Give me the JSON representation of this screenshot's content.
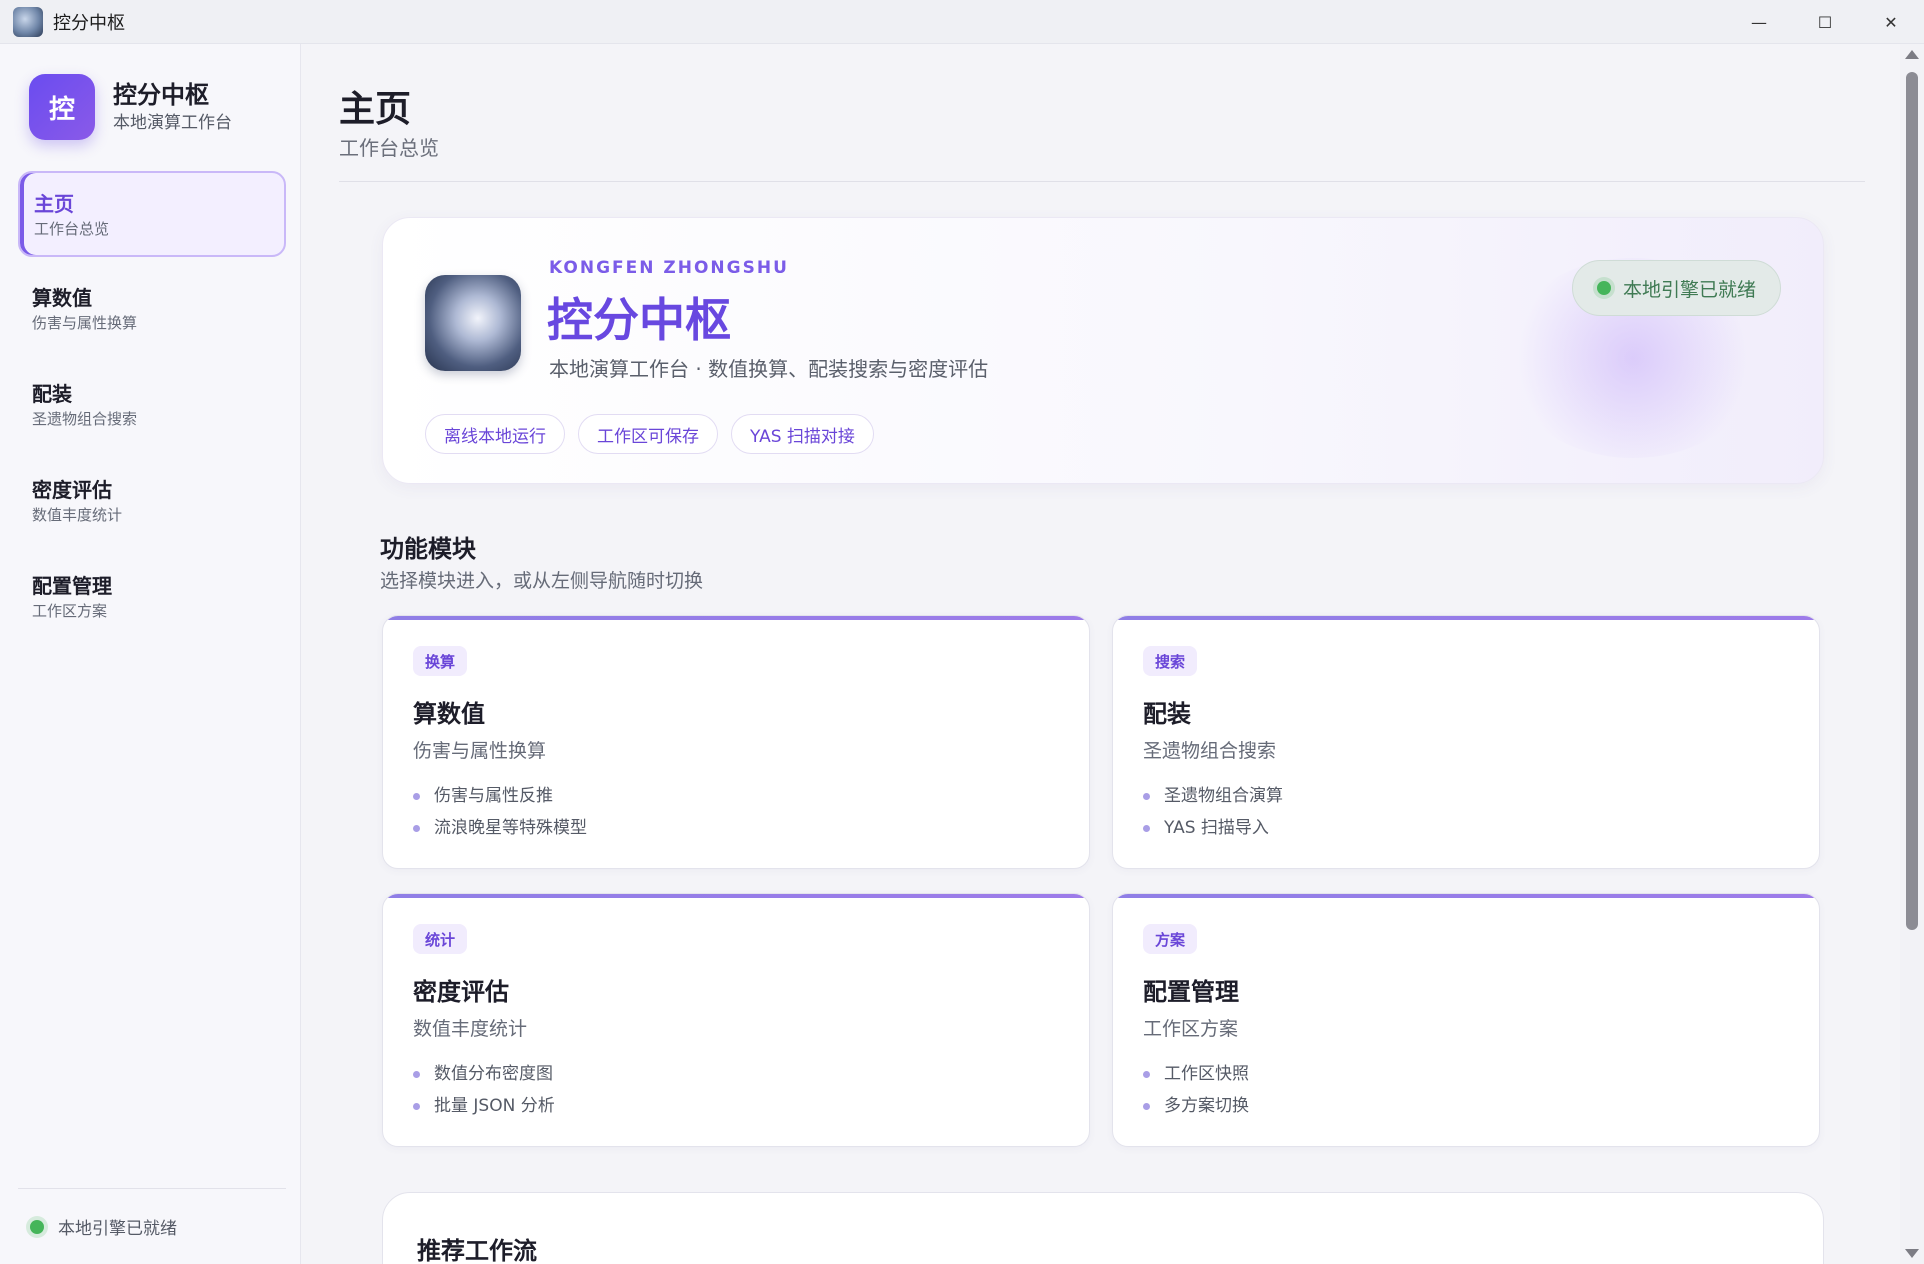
{
  "window": {
    "title": "控分中枢",
    "controls": {
      "minimize": "—",
      "maximize": "☐",
      "close": "✕"
    }
  },
  "sidebar": {
    "brand": {
      "logo_text": "控",
      "title": "控分中枢",
      "subtitle": "本地演算工作台"
    },
    "items": [
      {
        "label": "主页",
        "sub": "工作台总览",
        "active": true
      },
      {
        "label": "算数值",
        "sub": "伤害与属性换算",
        "active": false
      },
      {
        "label": "配装",
        "sub": "圣遗物组合搜索",
        "active": false
      },
      {
        "label": "密度评估",
        "sub": "数值丰度统计",
        "active": false
      },
      {
        "label": "配置管理",
        "sub": "工作区方案",
        "active": false
      }
    ],
    "footer_status": "本地引擎已就绪"
  },
  "page": {
    "title": "主页",
    "subtitle": "工作台总览"
  },
  "hero": {
    "eyebrow": "KONGFEN ZHONGSHU",
    "title": "控分中枢",
    "description": "本地演算工作台 · 数值换算、配装搜索与密度评估",
    "tags": [
      "离线本地运行",
      "工作区可保存",
      "YAS 扫描对接"
    ],
    "status": "本地引擎已就绪"
  },
  "modules": {
    "title": "功能模块",
    "subtitle": "选择模块进入，或从左侧导航随时切换",
    "cards": [
      {
        "badge": "换算",
        "title": "算数值",
        "sub": "伤害与属性换算",
        "points": [
          "伤害与属性反推",
          "流浪晚星等特殊模型"
        ]
      },
      {
        "badge": "搜索",
        "title": "配装",
        "sub": "圣遗物组合搜索",
        "points": [
          "圣遗物组合演算",
          "YAS 扫描导入"
        ]
      },
      {
        "badge": "统计",
        "title": "密度评估",
        "sub": "数值丰度统计",
        "points": [
          "数值分布密度图",
          "批量 JSON 分析"
        ]
      },
      {
        "badge": "方案",
        "title": "配置管理",
        "sub": "工作区方案",
        "points": [
          "工作区快照",
          "多方案切换"
        ]
      }
    ]
  },
  "workflow": {
    "title": "推荐工作流"
  },
  "colors": {
    "accent": "#6a46d8",
    "status_green": "#45b55a"
  }
}
